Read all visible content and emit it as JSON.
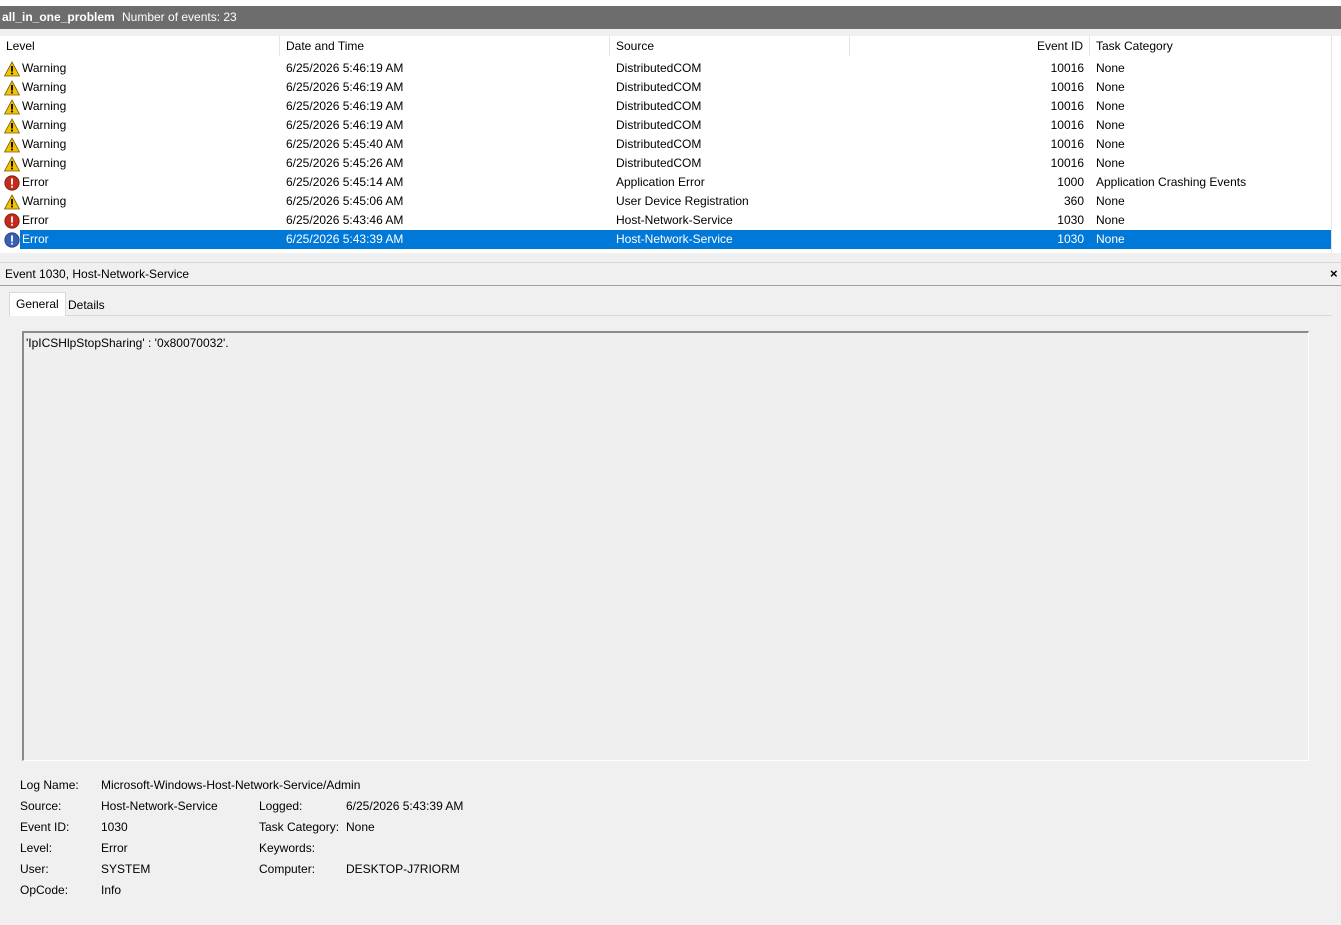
{
  "header": {
    "log_name": "all_in_one_problem",
    "event_count": "Number of events: 23"
  },
  "columns": {
    "level": "Level",
    "date": "Date and Time",
    "source": "Source",
    "event_id": "Event ID",
    "task": "Task Category"
  },
  "events": [
    {
      "icon": "warning-icon",
      "level": "Warning",
      "date": "6/25/2026 5:46:19 AM",
      "source": "DistributedCOM",
      "id": "10016",
      "task": "None"
    },
    {
      "icon": "warning-icon",
      "level": "Warning",
      "date": "6/25/2026 5:46:19 AM",
      "source": "DistributedCOM",
      "id": "10016",
      "task": "None"
    },
    {
      "icon": "warning-icon",
      "level": "Warning",
      "date": "6/25/2026 5:46:19 AM",
      "source": "DistributedCOM",
      "id": "10016",
      "task": "None"
    },
    {
      "icon": "warning-icon",
      "level": "Warning",
      "date": "6/25/2026 5:46:19 AM",
      "source": "DistributedCOM",
      "id": "10016",
      "task": "None"
    },
    {
      "icon": "warning-icon",
      "level": "Warning",
      "date": "6/25/2026 5:45:40 AM",
      "source": "DistributedCOM",
      "id": "10016",
      "task": "None"
    },
    {
      "icon": "warning-icon",
      "level": "Warning",
      "date": "6/25/2026 5:45:26 AM",
      "source": "DistributedCOM",
      "id": "10016",
      "task": "None"
    },
    {
      "icon": "error-icon",
      "level": "Error",
      "date": "6/25/2026 5:45:14 AM",
      "source": "Application Error",
      "id": "1000",
      "task": "Application Crashing Events"
    },
    {
      "icon": "warning-icon",
      "level": "Warning",
      "date": "6/25/2026 5:45:06 AM",
      "source": "User Device Registration",
      "id": "360",
      "task": "None"
    },
    {
      "icon": "error-icon",
      "level": "Error",
      "date": "6/25/2026 5:43:46 AM",
      "source": "Host-Network-Service",
      "id": "1030",
      "task": "None"
    },
    {
      "icon": "error-icon",
      "level": "Error",
      "date": "6/25/2026 5:43:39 AM",
      "source": "Host-Network-Service",
      "id": "1030",
      "task": "None",
      "selected": true
    }
  ],
  "detail": {
    "title": "Event 1030, Host-Network-Service",
    "close_glyph": "×",
    "tabs": {
      "general": "General",
      "details": "Details"
    },
    "description": "'IpICSHlpStopSharing' : '0x80070032'.",
    "fields": {
      "log_name_label": "Log Name:",
      "log_name": "Microsoft-Windows-Host-Network-Service/Admin",
      "source_label": "Source:",
      "source": "Host-Network-Service",
      "logged_label": "Logged:",
      "logged": "6/25/2026 5:43:39 AM",
      "event_id_label": "Event ID:",
      "event_id": "1030",
      "task_category_label": "Task Category:",
      "task_category": "None",
      "level_label": "Level:",
      "level": "Error",
      "keywords_label": "Keywords:",
      "keywords": "",
      "user_label": "User:",
      "user": "SYSTEM",
      "computer_label": "Computer:",
      "computer": "DESKTOP-J7RIORM",
      "opcode_label": "OpCode:",
      "opcode": "Info"
    }
  },
  "colors": {
    "title_bar": "#6d6d6d",
    "selection": "#0078d7",
    "warning": "#f5c400",
    "error": "#c42b1c"
  }
}
